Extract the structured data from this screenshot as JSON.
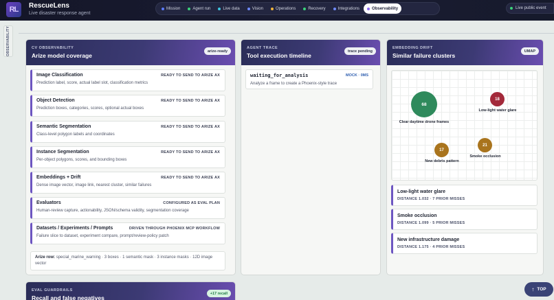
{
  "app": {
    "name": "RescueLens",
    "tagline": "Live disaster response agent",
    "logo_text": "RL"
  },
  "nav": [
    {
      "label": "Mission",
      "color": "#5b7cff"
    },
    {
      "label": "Agent run",
      "color": "#3bd27a"
    },
    {
      "label": "Live data",
      "color": "#3ec6e0"
    },
    {
      "label": "Vision",
      "color": "#6f8bff"
    },
    {
      "label": "Operations",
      "color": "#f0b43a"
    },
    {
      "label": "Recovery",
      "color": "#3bd27a"
    },
    {
      "label": "Integrations",
      "color": "#6f8bff"
    },
    {
      "label": "Observability",
      "color": "#8c6bf0",
      "active": true
    }
  ],
  "live_event": {
    "label": "Live public event"
  },
  "side_tab": "OBSERVABILITY",
  "cv_card": {
    "kicker": "CV OBSERVABILITY",
    "title": "Arize model coverage",
    "pill": "arize-ready",
    "rows": [
      {
        "name": "Image Classification",
        "status": "READY TO SEND TO ARIZE AX",
        "desc": "Prediction label, score, actual label slot, classification metrics"
      },
      {
        "name": "Object Detection",
        "status": "READY TO SEND TO ARIZE AX",
        "desc": "Prediction boxes, categories, scores, optional actual boxes"
      },
      {
        "name": "Semantic Segmentation",
        "status": "READY TO SEND TO ARIZE AX",
        "desc": "Class-level polygon labels and coordinates"
      },
      {
        "name": "Instance Segmentation",
        "status": "READY TO SEND TO ARIZE AX",
        "desc": "Per-object polygons, scores, and bounding boxes"
      },
      {
        "name": "Embeddings + Drift",
        "status": "READY TO SEND TO ARIZE AX",
        "desc": "Dense image vector, image link, nearest cluster, similar failures"
      },
      {
        "name": "Evaluators",
        "status": "CONFIGURED AS EVAL PLAN",
        "desc": "Human-review capture, actionability, JSON/schema validity, segmentation coverage"
      },
      {
        "name": "Datasets / Experiments / Prompts",
        "status": "DRIVEN THROUGH PHOENIX MCP WORKFLOW",
        "desc": "Failure slice to dataset, experiment compare, prompt/review-policy patch"
      }
    ],
    "arize_row": {
      "label": "Arize row:",
      "text": "special_marine_warning · 3 boxes · 1 semantic mask · 3 instance masks · 12D image vector"
    }
  },
  "trace_card": {
    "kicker": "AGENT TRACE",
    "title": "Tool execution timeline",
    "pill": "trace pending",
    "rows": [
      {
        "name": "waiting_for_analysis",
        "meta": "MOCK · 0MS",
        "desc": "Analyze a frame to create a Phoenix-style trace"
      }
    ]
  },
  "drift_card": {
    "kicker": "EMBEDDING DRIFT",
    "title": "Similar failure clusters",
    "pill": "UMAP",
    "bubbles": [
      {
        "value": "68",
        "label": "Clear daytime drone frames",
        "color": "#2f8a5c"
      },
      {
        "value": "18",
        "label": "Low-light water glare",
        "color": "#a3293a"
      },
      {
        "value": "17",
        "label": "New debris pattern",
        "color": "#a9741d"
      },
      {
        "value": "21",
        "label": "Smoke occlusion",
        "color": "#a9741d"
      }
    ],
    "clusters": [
      {
        "name": "Low-light water glare",
        "meta": "DISTANCE 1.032 · 7 PRIOR MISSES"
      },
      {
        "name": "Smoke occlusion",
        "meta": "DISTANCE 1.099 · 5 PRIOR MISSES"
      },
      {
        "name": "New infrastructure damage",
        "meta": "DISTANCE 1.175 · 4 PRIOR MISSES"
      }
    ]
  },
  "eval_card": {
    "kicker": "EVAL GUARDRAILS",
    "title": "Recall and false negatives",
    "pill": "+17 recall"
  },
  "top_button": {
    "label": "TOP"
  }
}
